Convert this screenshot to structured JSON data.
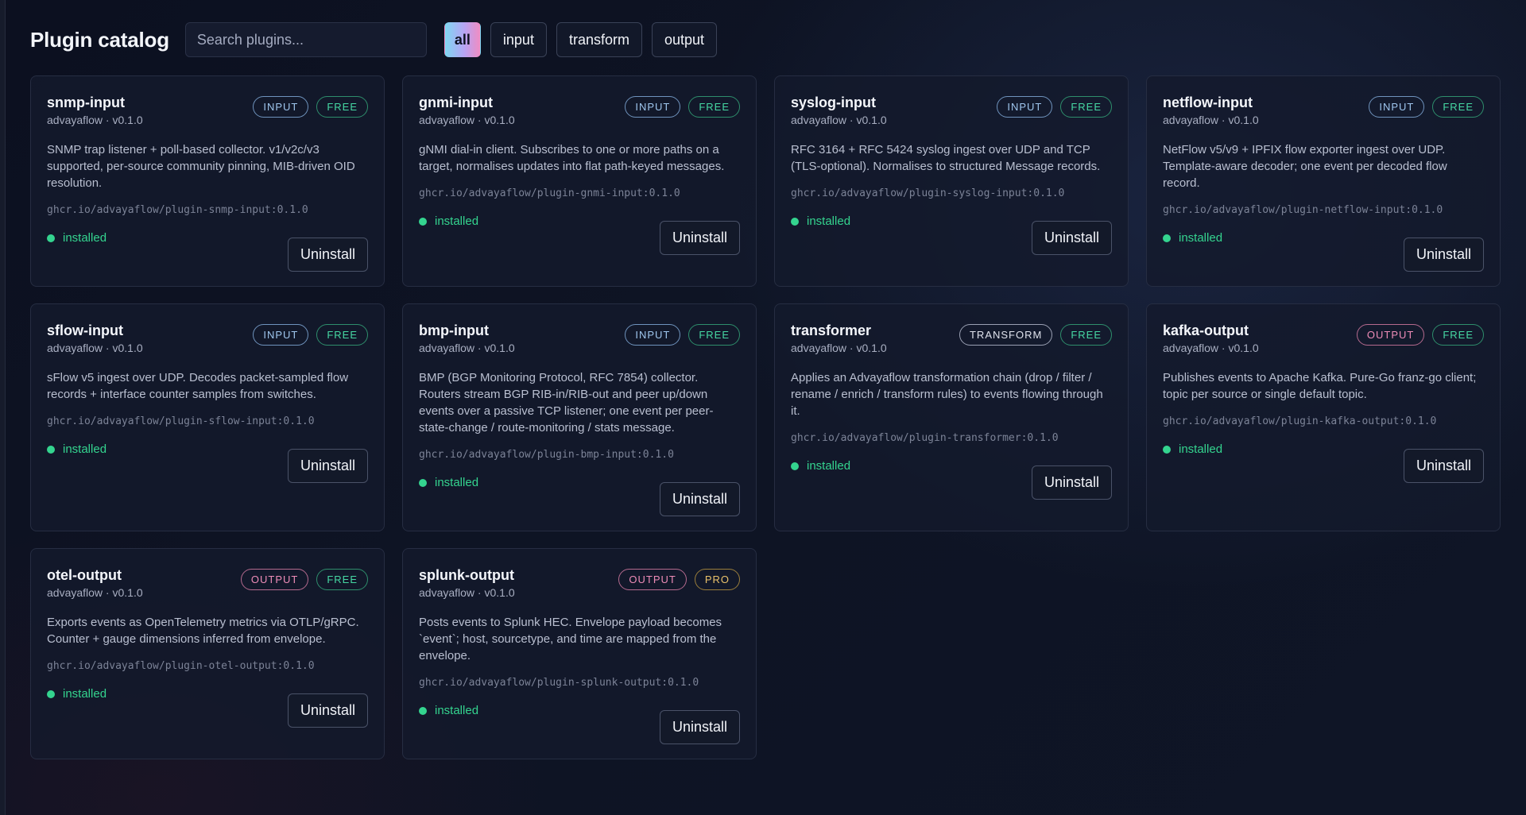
{
  "page": {
    "title": "Plugin catalog"
  },
  "search": {
    "placeholder": "Search plugins..."
  },
  "filters": [
    {
      "label": "all",
      "active": true
    },
    {
      "label": "input",
      "active": false
    },
    {
      "label": "transform",
      "active": false
    },
    {
      "label": "output",
      "active": false
    }
  ],
  "colors": {
    "installed": "#34d48f",
    "badge_input": "#9fc6ee",
    "badge_output": "#ee8cb7",
    "badge_free": "#46d8a3",
    "badge_pro": "#e9c16a"
  },
  "plugins": [
    {
      "name": "snmp-input",
      "meta": "advayaflow · v0.1.0",
      "kind": "INPUT",
      "license": "FREE",
      "description": "SNMP trap listener + poll-based collector. v1/v2c/v3 supported, per-source community pinning, MIB-driven OID resolution.",
      "image": "ghcr.io/advayaflow/plugin-snmp-input:0.1.0",
      "status": "installed",
      "action": "Uninstall"
    },
    {
      "name": "gnmi-input",
      "meta": "advayaflow · v0.1.0",
      "kind": "INPUT",
      "license": "FREE",
      "description": "gNMI dial-in client. Subscribes to one or more paths on a target, normalises updates into flat path-keyed messages.",
      "image": "ghcr.io/advayaflow/plugin-gnmi-input:0.1.0",
      "status": "installed",
      "action": "Uninstall"
    },
    {
      "name": "syslog-input",
      "meta": "advayaflow · v0.1.0",
      "kind": "INPUT",
      "license": "FREE",
      "description": "RFC 3164 + RFC 5424 syslog ingest over UDP and TCP (TLS-optional). Normalises to structured Message records.",
      "image": "ghcr.io/advayaflow/plugin-syslog-input:0.1.0",
      "status": "installed",
      "action": "Uninstall"
    },
    {
      "name": "netflow-input",
      "meta": "advayaflow · v0.1.0",
      "kind": "INPUT",
      "license": "FREE",
      "description": "NetFlow v5/v9 + IPFIX flow exporter ingest over UDP. Template-aware decoder; one event per decoded flow record.",
      "image": "ghcr.io/advayaflow/plugin-netflow-input:0.1.0",
      "status": "installed",
      "action": "Uninstall"
    },
    {
      "name": "sflow-input",
      "meta": "advayaflow · v0.1.0",
      "kind": "INPUT",
      "license": "FREE",
      "description": "sFlow v5 ingest over UDP. Decodes packet-sampled flow records + interface counter samples from switches.",
      "image": "ghcr.io/advayaflow/plugin-sflow-input:0.1.0",
      "status": "installed",
      "action": "Uninstall"
    },
    {
      "name": "bmp-input",
      "meta": "advayaflow · v0.1.0",
      "kind": "INPUT",
      "license": "FREE",
      "description": "BMP (BGP Monitoring Protocol, RFC 7854) collector. Routers stream BGP RIB-in/RIB-out and peer up/down events over a passive TCP listener; one event per peer-state-change / route-monitoring / stats message.",
      "image": "ghcr.io/advayaflow/plugin-bmp-input:0.1.0",
      "status": "installed",
      "action": "Uninstall"
    },
    {
      "name": "transformer",
      "meta": "advayaflow · v0.1.0",
      "kind": "TRANSFORM",
      "license": "FREE",
      "description": "Applies an Advayaflow transformation chain (drop / filter / rename / enrich / transform rules) to events flowing through it.",
      "image": "ghcr.io/advayaflow/plugin-transformer:0.1.0",
      "status": "installed",
      "action": "Uninstall"
    },
    {
      "name": "kafka-output",
      "meta": "advayaflow · v0.1.0",
      "kind": "OUTPUT",
      "license": "FREE",
      "description": "Publishes events to Apache Kafka. Pure-Go franz-go client; topic per source or single default topic.",
      "image": "ghcr.io/advayaflow/plugin-kafka-output:0.1.0",
      "status": "installed",
      "action": "Uninstall"
    },
    {
      "name": "otel-output",
      "meta": "advayaflow · v0.1.0",
      "kind": "OUTPUT",
      "license": "FREE",
      "description": "Exports events as OpenTelemetry metrics via OTLP/gRPC. Counter + gauge dimensions inferred from envelope.",
      "image": "ghcr.io/advayaflow/plugin-otel-output:0.1.0",
      "status": "installed",
      "action": "Uninstall"
    },
    {
      "name": "splunk-output",
      "meta": "advayaflow · v0.1.0",
      "kind": "OUTPUT",
      "license": "PRO",
      "description": "Posts events to Splunk HEC. Envelope payload becomes `event`; host, sourcetype, and time are mapped from the envelope.",
      "image": "ghcr.io/advayaflow/plugin-splunk-output:0.1.0",
      "status": "installed",
      "action": "Uninstall"
    }
  ]
}
